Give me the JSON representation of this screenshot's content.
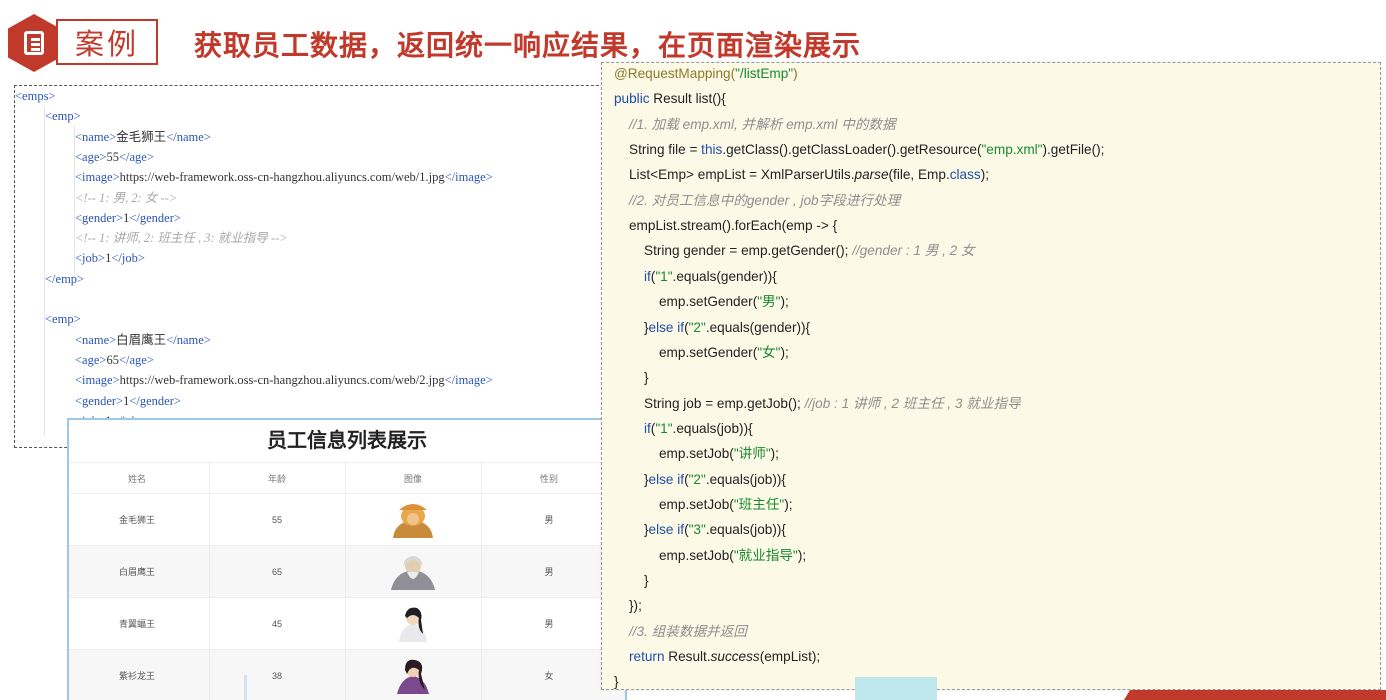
{
  "header": {
    "tag": "案例",
    "title": "获取员工数据，返回统一响应结果，在页面渲染展示"
  },
  "xml": {
    "lines": [
      {
        "ind": 0,
        "segs": [
          {
            "t": "<emps>",
            "c": "tg"
          }
        ]
      },
      {
        "ind": 1,
        "segs": [
          {
            "t": "<emp>",
            "c": "tg"
          }
        ]
      },
      {
        "ind": 2,
        "segs": [
          {
            "t": "<name>",
            "c": "tg"
          },
          {
            "t": "金毛狮王",
            "c": ""
          },
          {
            "t": "</name>",
            "c": "tg"
          }
        ]
      },
      {
        "ind": 2,
        "segs": [
          {
            "t": "<age>",
            "c": "tg"
          },
          {
            "t": "55",
            "c": ""
          },
          {
            "t": "</age>",
            "c": "tg"
          }
        ]
      },
      {
        "ind": 2,
        "segs": [
          {
            "t": "<image>",
            "c": "tg"
          },
          {
            "t": "https://web-framework.oss-cn-hangzhou.aliyuncs.com/web/1.jpg",
            "c": ""
          },
          {
            "t": "</image>",
            "c": "tg"
          }
        ]
      },
      {
        "ind": 2,
        "segs": [
          {
            "t": "<!-- 1: 男, 2: 女 -->",
            "c": "cm"
          }
        ]
      },
      {
        "ind": 2,
        "segs": [
          {
            "t": "<gender>",
            "c": "tg"
          },
          {
            "t": "1",
            "c": ""
          },
          {
            "t": "</gender>",
            "c": "tg"
          }
        ]
      },
      {
        "ind": 2,
        "segs": [
          {
            "t": "<!-- 1: 讲师, 2: 班主任 , 3: 就业指导 -->",
            "c": "cm"
          }
        ]
      },
      {
        "ind": 2,
        "segs": [
          {
            "t": "<job>",
            "c": "tg"
          },
          {
            "t": "1",
            "c": ""
          },
          {
            "t": "</job>",
            "c": "tg"
          }
        ]
      },
      {
        "ind": 1,
        "segs": [
          {
            "t": "</emp>",
            "c": "tg"
          }
        ]
      },
      {
        "ind": 0,
        "segs": []
      },
      {
        "ind": 1,
        "segs": [
          {
            "t": "<emp>",
            "c": "tg"
          }
        ]
      },
      {
        "ind": 2,
        "segs": [
          {
            "t": "<name>",
            "c": "tg"
          },
          {
            "t": "白眉鹰王",
            "c": ""
          },
          {
            "t": "</name>",
            "c": "tg"
          }
        ]
      },
      {
        "ind": 2,
        "segs": [
          {
            "t": "<age>",
            "c": "tg"
          },
          {
            "t": "65",
            "c": ""
          },
          {
            "t": "</age>",
            "c": "tg"
          }
        ]
      },
      {
        "ind": 2,
        "segs": [
          {
            "t": "<image>",
            "c": "tg"
          },
          {
            "t": "https://web-framework.oss-cn-hangzhou.aliyuncs.com/web/2.jpg",
            "c": ""
          },
          {
            "t": "</image>",
            "c": "tg"
          }
        ]
      },
      {
        "ind": 2,
        "segs": [
          {
            "t": "<gender>",
            "c": "tg"
          },
          {
            "t": "1",
            "c": ""
          },
          {
            "t": "</gender>",
            "c": "tg"
          }
        ]
      },
      {
        "ind": 2,
        "segs": [
          {
            "t": "<job>",
            "c": "tg"
          },
          {
            "t": "1",
            "c": ""
          },
          {
            "t": "</job>",
            "c": "tg"
          }
        ]
      }
    ]
  },
  "table": {
    "title": "员工信息列表展示",
    "headers": [
      "姓名",
      "年龄",
      "图像",
      "性别"
    ],
    "rows": [
      {
        "name": "金毛狮王",
        "age": "55",
        "avatar": "avatar-1",
        "gender": "男"
      },
      {
        "name": "白眉鹰王",
        "age": "65",
        "avatar": "avatar-2",
        "gender": "男"
      },
      {
        "name": "青翼蝠王",
        "age": "45",
        "avatar": "avatar-3",
        "gender": "男"
      },
      {
        "name": "紫衫龙王",
        "age": "38",
        "avatar": "avatar-4",
        "gender": "女"
      }
    ]
  },
  "code": {
    "lines": [
      {
        "ind": 0,
        "segs": [
          {
            "t": "@RequestMapping(",
            "c": "ann"
          },
          {
            "t": "\"/listEmp\"",
            "c": "str"
          },
          {
            "t": ")",
            "c": "ann"
          }
        ]
      },
      {
        "ind": 0,
        "segs": [
          {
            "t": "public ",
            "c": "kw"
          },
          {
            "t": "Result list(){",
            "c": ""
          }
        ]
      },
      {
        "ind": 1,
        "segs": [
          {
            "t": "//1. 加载 emp.xml, 并解析 emp.xml 中的数据",
            "c": "com"
          }
        ]
      },
      {
        "ind": 1,
        "segs": [
          {
            "t": "String file = ",
            "c": ""
          },
          {
            "t": "this",
            "c": "kw"
          },
          {
            "t": ".getClass().getClassLoader().getResource(",
            "c": ""
          },
          {
            "t": "\"emp.xml\"",
            "c": "str"
          },
          {
            "t": ").getFile();",
            "c": ""
          }
        ]
      },
      {
        "ind": 1,
        "segs": [
          {
            "t": "List<Emp> empList = XmlParserUtils.",
            "c": ""
          },
          {
            "t": "parse",
            "c": "it"
          },
          {
            "t": "(file, Emp.",
            "c": ""
          },
          {
            "t": "class",
            "c": "kw"
          },
          {
            "t": ");",
            "c": ""
          }
        ]
      },
      {
        "ind": 1,
        "segs": [
          {
            "t": "//2. 对员工信息中的gender , job字段进行处理",
            "c": "com"
          }
        ]
      },
      {
        "ind": 1,
        "segs": [
          {
            "t": "empList.stream().forEach(emp -> {",
            "c": ""
          }
        ]
      },
      {
        "ind": 2,
        "segs": [
          {
            "t": "String gender = emp.getGender(); ",
            "c": ""
          },
          {
            "t": "//gender : 1 男 , 2 女",
            "c": "com"
          }
        ]
      },
      {
        "ind": 2,
        "segs": [
          {
            "t": "if",
            "c": "kw"
          },
          {
            "t": "(",
            "c": ""
          },
          {
            "t": "\"1\"",
            "c": "str"
          },
          {
            "t": ".equals(gender)){",
            "c": ""
          }
        ]
      },
      {
        "ind": 3,
        "segs": [
          {
            "t": "emp.setGender(",
            "c": ""
          },
          {
            "t": "\"男\"",
            "c": "str"
          },
          {
            "t": ");",
            "c": ""
          }
        ]
      },
      {
        "ind": 2,
        "segs": [
          {
            "t": "}",
            "c": ""
          },
          {
            "t": "else if",
            "c": "kw"
          },
          {
            "t": "(",
            "c": ""
          },
          {
            "t": "\"2\"",
            "c": "str"
          },
          {
            "t": ".equals(gender)){",
            "c": ""
          }
        ]
      },
      {
        "ind": 3,
        "segs": [
          {
            "t": "emp.setGender(",
            "c": ""
          },
          {
            "t": "\"女\"",
            "c": "str"
          },
          {
            "t": ");",
            "c": ""
          }
        ]
      },
      {
        "ind": 2,
        "segs": [
          {
            "t": "}",
            "c": ""
          }
        ]
      },
      {
        "ind": 2,
        "segs": [
          {
            "t": "String job = emp.getJob(); ",
            "c": ""
          },
          {
            "t": "//job : 1 讲师 , 2 班主任 , 3 就业指导",
            "c": "com"
          }
        ]
      },
      {
        "ind": 2,
        "segs": [
          {
            "t": "if",
            "c": "kw"
          },
          {
            "t": "(",
            "c": ""
          },
          {
            "t": "\"1\"",
            "c": "str"
          },
          {
            "t": ".equals(job)){",
            "c": ""
          }
        ]
      },
      {
        "ind": 3,
        "segs": [
          {
            "t": "emp.setJob(",
            "c": ""
          },
          {
            "t": "\"讲师\"",
            "c": "str"
          },
          {
            "t": ");",
            "c": ""
          }
        ]
      },
      {
        "ind": 2,
        "segs": [
          {
            "t": "}",
            "c": ""
          },
          {
            "t": "else if",
            "c": "kw"
          },
          {
            "t": "(",
            "c": ""
          },
          {
            "t": "\"2\"",
            "c": "str"
          },
          {
            "t": ".equals(job)){",
            "c": ""
          }
        ]
      },
      {
        "ind": 3,
        "segs": [
          {
            "t": "emp.setJob(",
            "c": ""
          },
          {
            "t": "\"班主任\"",
            "c": "str"
          },
          {
            "t": ");",
            "c": ""
          }
        ]
      },
      {
        "ind": 2,
        "segs": [
          {
            "t": "}",
            "c": ""
          },
          {
            "t": "else if",
            "c": "kw"
          },
          {
            "t": "(",
            "c": ""
          },
          {
            "t": "\"3\"",
            "c": "str"
          },
          {
            "t": ".equals(job)){",
            "c": ""
          }
        ]
      },
      {
        "ind": 3,
        "segs": [
          {
            "t": "emp.setJob(",
            "c": ""
          },
          {
            "t": "\"就业指导\"",
            "c": "str"
          },
          {
            "t": ");",
            "c": ""
          }
        ]
      },
      {
        "ind": 2,
        "segs": [
          {
            "t": "}",
            "c": ""
          }
        ]
      },
      {
        "ind": 1,
        "segs": [
          {
            "t": "});",
            "c": ""
          }
        ]
      },
      {
        "ind": 1,
        "segs": [
          {
            "t": "//3. 组装数据并返回",
            "c": "com"
          }
        ]
      },
      {
        "ind": 1,
        "segs": [
          {
            "t": "return ",
            "c": "kw"
          },
          {
            "t": "Result.",
            "c": ""
          },
          {
            "t": "success",
            "c": "it"
          },
          {
            "t": "(empList);",
            "c": ""
          }
        ]
      },
      {
        "ind": 0,
        "segs": [
          {
            "t": "}",
            "c": ""
          }
        ]
      }
    ]
  },
  "colors": {
    "accent": "#c0392b",
    "code_bg": "#fdf9e7",
    "keyword": "#1f4ea8",
    "string": "#178a2e",
    "comment": "#8e8e8e"
  }
}
